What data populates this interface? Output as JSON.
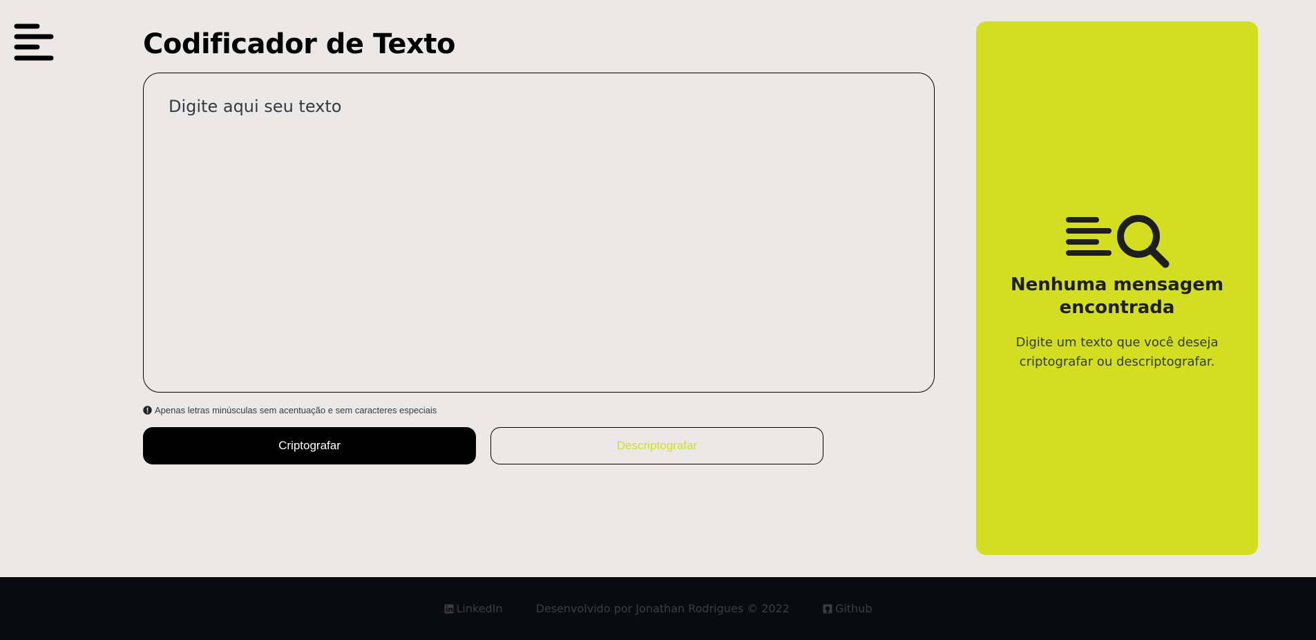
{
  "menu": {
    "icon": "menu-icon"
  },
  "header": {
    "title": "Codificador de Texto"
  },
  "input": {
    "placeholder": "Digite aqui seu texto",
    "value": ""
  },
  "hint": {
    "icon": "alert-circle-icon",
    "text": "Apenas letras minúsculas sem acentuação e sem caracteres especiais"
  },
  "actions": {
    "encrypt_label": "Criptografar",
    "decrypt_label": "Descriptografar"
  },
  "result_panel": {
    "illustration": "text-search-icon",
    "heading": "Nenhuma mensagem encontrada",
    "text": "Digite um texto que você deseja criptografar ou descriptografar."
  },
  "footer": {
    "linkedin_label": "LinkedIn",
    "credit": "Desenvolvido por Jonathan Rodrigues © 2022",
    "github_label": "Github"
  },
  "colors": {
    "background": "#EAE9E7",
    "accent": "#D4DE21",
    "primary_button": "#000000",
    "footer": "#0A0B0F"
  }
}
